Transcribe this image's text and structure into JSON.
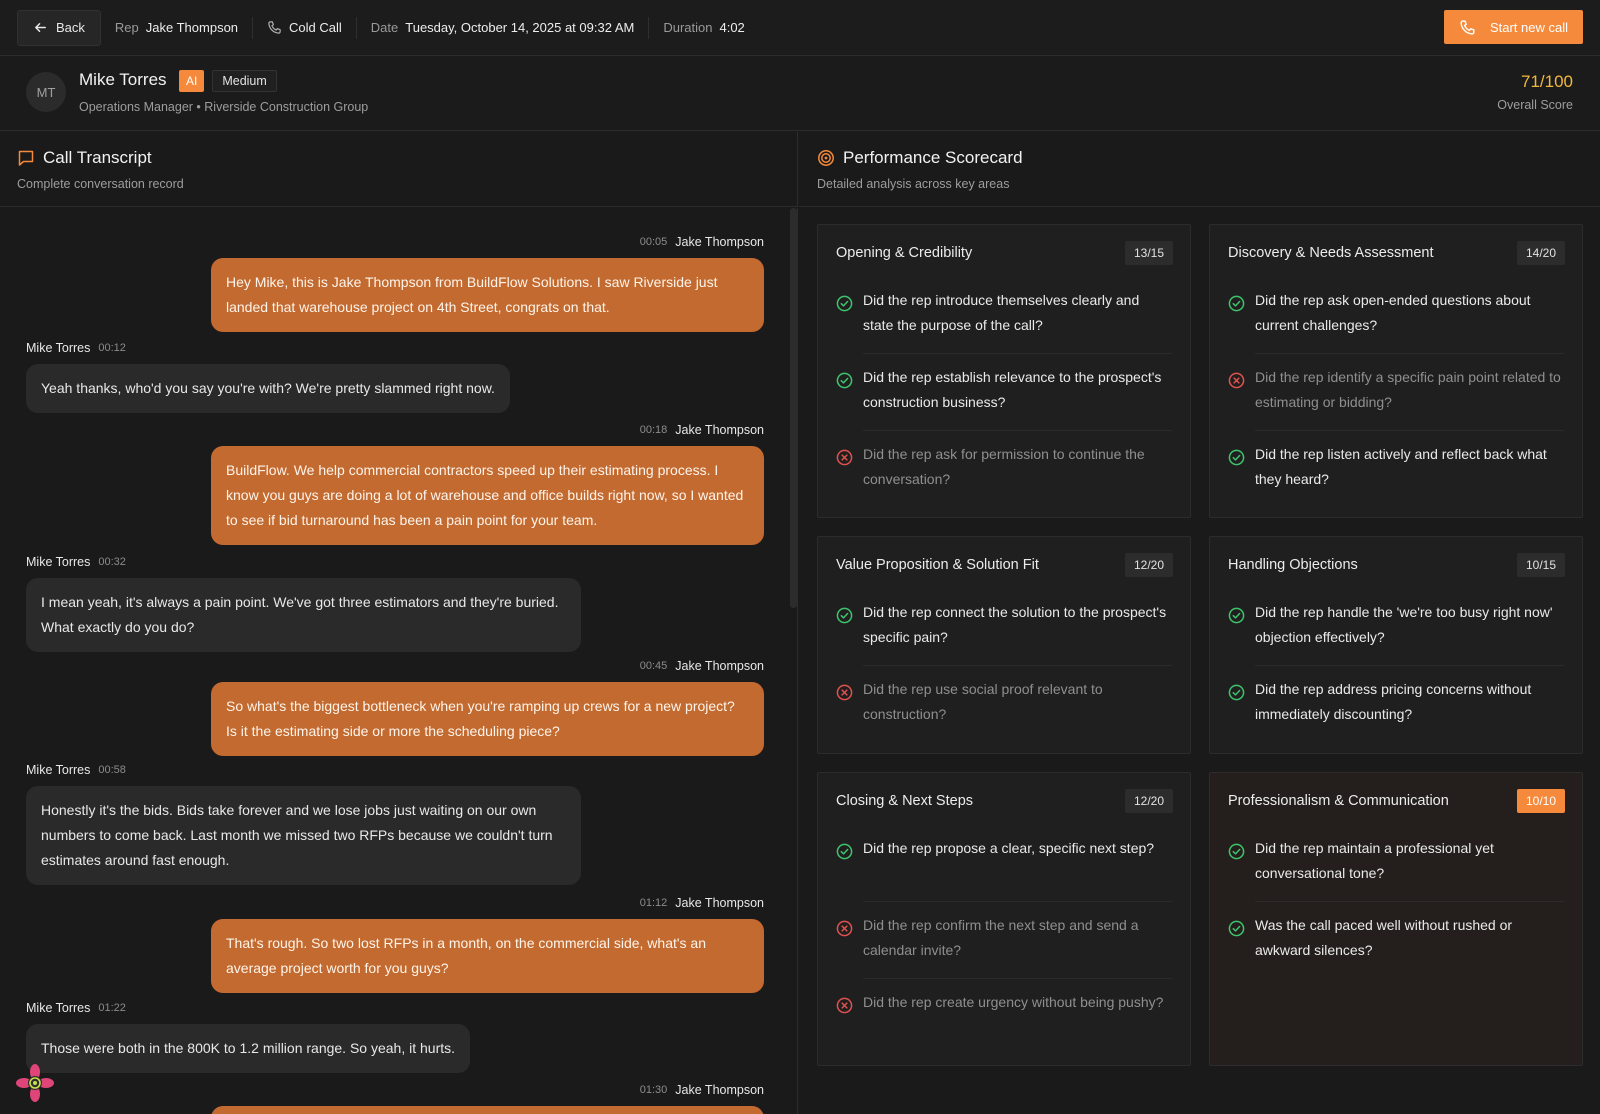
{
  "header": {
    "back_label": "Back",
    "rep_label": "Rep",
    "rep_name": "Jake Thompson",
    "call_type": "Cold Call",
    "date_label": "Date",
    "date_value": "Tuesday, October 14, 2025 at 09:32 AM",
    "duration_label": "Duration",
    "duration_value": "4:02",
    "start_label": "Start new call"
  },
  "prospect": {
    "initials": "MT",
    "name": "Mike Torres",
    "ai_badge": "AI",
    "difficulty": "Medium",
    "title": "Operations Manager • Riverside Construction Group",
    "score": "71/100",
    "score_label": "Overall Score"
  },
  "transcript": {
    "title": "Call Transcript",
    "subtitle": "Complete conversation record",
    "messages": [
      {
        "speaker": "Jake Thompson",
        "time": "00:05",
        "text": "Hey Mike, this is Jake Thompson from BuildFlow Solutions. I saw Riverside just landed that warehouse project on 4th Street, congrats on that."
      },
      {
        "speaker": "Mike Torres",
        "time": "00:12",
        "text": "Yeah thanks, who'd you say you're with? We're pretty slammed right now."
      },
      {
        "speaker": "Jake Thompson",
        "time": "00:18",
        "text": "BuildFlow. We help commercial contractors speed up their estimating process. I know you guys are doing a lot of warehouse and office builds right now, so I wanted to see if bid turnaround has been a pain point for your team."
      },
      {
        "speaker": "Mike Torres",
        "time": "00:32",
        "text": "I mean yeah, it's always a pain point. We've got three estimators and they're buried. What exactly do you do?"
      },
      {
        "speaker": "Jake Thompson",
        "time": "00:45",
        "text": "So what's the biggest bottleneck when you're ramping up crews for a new project? Is it the estimating side or more the scheduling piece?"
      },
      {
        "speaker": "Mike Torres",
        "time": "00:58",
        "text": "Honestly it's the bids. Bids take forever and we lose jobs just waiting on our own numbers to come back. Last month we missed two RFPs because we couldn't turn estimates around fast enough."
      },
      {
        "speaker": "Jake Thompson",
        "time": "01:12",
        "text": "That's rough. So two lost RFPs in a month, on the commercial side, what's an average project worth for you guys?"
      },
      {
        "speaker": "Mike Torres",
        "time": "01:22",
        "text": "Those were both in the 800K to 1.2 million range. So yeah, it hurts."
      },
      {
        "speaker": "Jake Thompson",
        "time": "01:30",
        "text": ""
      }
    ]
  },
  "scorecard": {
    "title": "Performance Scorecard",
    "subtitle": "Detailed analysis across key areas",
    "cards": [
      {
        "title": "Opening & Credibility",
        "score": "13/15",
        "items": [
          {
            "text": "Did the rep introduce themselves clearly and state the purpose of the call?",
            "passed": true
          },
          {
            "text": "Did the rep establish relevance to the prospect's construction business?",
            "passed": true
          },
          {
            "text": "Did the rep ask for permission to continue the conversation?",
            "passed": false
          }
        ]
      },
      {
        "title": "Discovery & Needs Assessment",
        "score": "14/20",
        "items": [
          {
            "text": "Did the rep ask open-ended questions about current challenges?",
            "passed": true
          },
          {
            "text": "Did the rep identify a specific pain point related to estimating or bidding?",
            "passed": false
          },
          {
            "text": "Did the rep listen actively and reflect back what they heard?",
            "passed": true
          }
        ]
      },
      {
        "title": "Value Proposition & Solution Fit",
        "score": "12/20",
        "items": [
          {
            "text": "Did the rep connect the solution to the prospect's specific pain?",
            "passed": true
          },
          {
            "text": "Did the rep use social proof relevant to construction?",
            "passed": false
          }
        ]
      },
      {
        "title": "Handling Objections",
        "score": "10/15",
        "items": [
          {
            "text": "Did the rep handle the 'we're too busy right now' objection effectively?",
            "passed": true
          },
          {
            "text": "Did the rep address pricing concerns without immediately discounting?",
            "passed": true
          }
        ]
      },
      {
        "title": "Closing & Next Steps",
        "score": "12/20",
        "items": [
          {
            "text": "Did the rep propose a clear, specific next step?",
            "passed": true
          },
          {
            "text": "Did the rep confirm the next step and send a calendar invite?",
            "passed": false
          },
          {
            "text": "Did the rep create urgency without being pushy?",
            "passed": false
          }
        ]
      },
      {
        "title": "Professionalism & Communication",
        "score": "10/10",
        "items": [
          {
            "text": "Did the rep maintain a professional yet conversational tone?",
            "passed": true
          },
          {
            "text": "Was the call paced well without rushed or awkward silences?",
            "passed": true
          }
        ]
      }
    ]
  },
  "colors": {
    "accent": "#f58a3c",
    "rep_bubble": "#c26a30",
    "pass": "#3ec46d",
    "fail": "#e0524f",
    "score": "#f2b83e"
  }
}
